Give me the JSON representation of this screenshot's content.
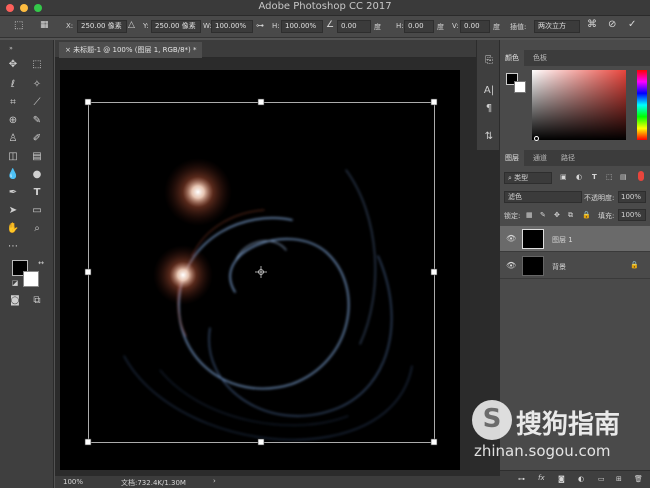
{
  "app_title": "Adobe Photoshop CC 2017",
  "options_bar": {
    "x_label": "X:",
    "x_value": "250.00 像素",
    "y_label": "Y:",
    "y_value": "250.00 像素",
    "w_label": "W:",
    "w_value": "100.00%",
    "h_label": "H:",
    "h_value": "100.00%",
    "angle_value": "0.00",
    "angle_unit": "度",
    "hskew_label": "H:",
    "hskew_value": "0.00",
    "hskew_unit": "度",
    "vskew_label": "V:",
    "vskew_value": "0.00",
    "vskew_unit": "度",
    "interp_label": "插值:",
    "interp_value": "两次立方"
  },
  "document": {
    "tab_title": "未标题-1 @ 100% (图层 1, RGB/8*) *",
    "zoom": "100%",
    "doc_info": "文档:732.4K/1.30M"
  },
  "color_panel": {
    "tabs": [
      "颜色",
      "色板"
    ]
  },
  "layers_panel": {
    "tabs": [
      "图层",
      "通道",
      "路径"
    ],
    "filter_kind": "类型",
    "blend_mode": "滤色",
    "opacity_label": "不透明度:",
    "opacity_value": "100%",
    "lock_label": "锁定:",
    "fill_label": "填充:",
    "fill_value": "100%",
    "layers": [
      {
        "name": "图层 1",
        "selected": true
      },
      {
        "name": "背景",
        "selected": false
      }
    ]
  },
  "watermark": {
    "brand": "搜狗指南",
    "url": "zhinan.sogou.com"
  },
  "colors": {
    "accent_red": "#e8453c",
    "panel_bg": "#4a4a4a",
    "canvas_bg": "#000000"
  }
}
